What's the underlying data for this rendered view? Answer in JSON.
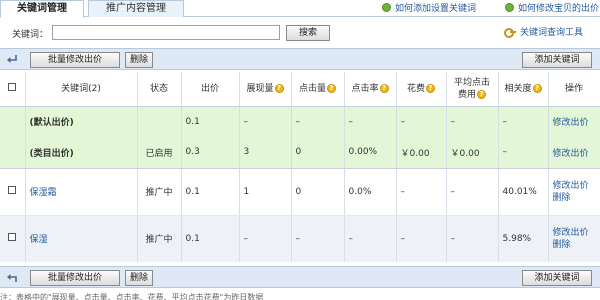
{
  "tabs": [
    {
      "label": "关键词管理",
      "active": true
    },
    {
      "label": "推广内容管理",
      "active": false
    }
  ],
  "help_links": [
    {
      "label": "如何添加设置关键词"
    },
    {
      "label": "如何修改宝贝的出价"
    }
  ],
  "search": {
    "label": "关键词：",
    "value": "",
    "button_label": "搜索"
  },
  "tool_link": {
    "label": "关键词查询工具",
    "icon": "key-icon"
  },
  "toolbar": {
    "batch_bid_label": "批量修改出价",
    "delete_label": "删除",
    "add_keyword_label": "添加关键词"
  },
  "table": {
    "columns": {
      "keyword": "关键词(2)",
      "state": "状态",
      "bid": "出价",
      "impressions": "展现量",
      "clicks": "点击量",
      "ctr": "点击率",
      "cost": "花费",
      "avg_cpc": "平均点击费用",
      "relevance": "相关度",
      "action": "操作"
    },
    "rows": [
      {
        "keyword": "(默认出价)",
        "state": "",
        "bid": "0.1",
        "impressions": "–",
        "clicks": "–",
        "ctr": "–",
        "cost": "–",
        "avg_cpc": "–",
        "relevance": "–",
        "actions": [
          "修改出价"
        ]
      },
      {
        "keyword": "(类目出价)",
        "state": "已启用",
        "bid": "0.3",
        "impressions": "3",
        "clicks": "0",
        "ctr": "0.00%",
        "cost": "￥0.00",
        "avg_cpc": "￥0.00",
        "relevance": "–",
        "actions": [
          "修改出价"
        ]
      },
      {
        "keyword": "保湿霜",
        "state": "推广中",
        "bid": "0.1",
        "impressions": "1",
        "clicks": "0",
        "ctr": "0.0%",
        "cost": "–",
        "avg_cpc": "–",
        "relevance": "40.01%",
        "actions": [
          "修改出价",
          "删除"
        ]
      },
      {
        "keyword": "保湿",
        "state": "推广中",
        "bid": "0.1",
        "impressions": "–",
        "clicks": "–",
        "ctr": "–",
        "cost": "–",
        "avg_cpc": "–",
        "relevance": "5.98%",
        "actions": [
          "修改出价",
          "删除"
        ]
      }
    ]
  },
  "footnote": "注：表格中的\"展现量、点击量、点击率、花费、平均点击花费\"为昨日数据",
  "colors": {
    "accent_link": "#245a9c",
    "highlight_rows": "#e3f6d6",
    "toolbar_bg": "#dfe9f5",
    "help_icon": "#6fb33a",
    "question_icon": "#f0b71a"
  }
}
